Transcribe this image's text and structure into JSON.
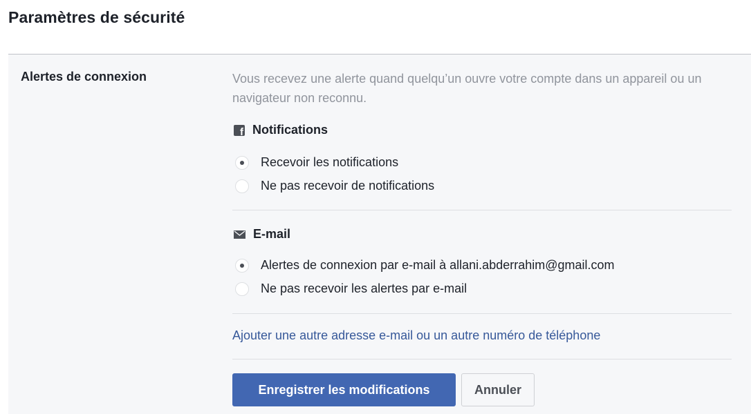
{
  "page": {
    "title": "Paramètres de sécurité"
  },
  "section": {
    "label": "Alertes de connexion",
    "description": "Vous recevez une alerte quand quelqu’un ouvre votre compte dans un appareil ou un navigateur non reconnu."
  },
  "notifications": {
    "header": "Notifications",
    "icon": "facebook-icon",
    "options": [
      {
        "label": "Recevoir les notifications",
        "checked": true
      },
      {
        "label": "Ne pas recevoir de notifications",
        "checked": false
      }
    ]
  },
  "email": {
    "header": "E-mail",
    "icon": "envelope-icon",
    "options": [
      {
        "label": "Alertes de connexion par e-mail à allani.abderrahim@gmail.com",
        "checked": true
      },
      {
        "label": "Ne pas recevoir les alertes par e-mail",
        "checked": false
      }
    ]
  },
  "add_contact_link": "Ajouter une autre adresse e-mail ou un autre numéro de téléphone",
  "buttons": {
    "save_label": "Enregistrer les modifications",
    "cancel_label": "Annuler"
  },
  "colors": {
    "primary_button": "#4267b2",
    "link": "#365899",
    "muted_text": "#90949c",
    "panel_background": "#f6f7f9"
  }
}
